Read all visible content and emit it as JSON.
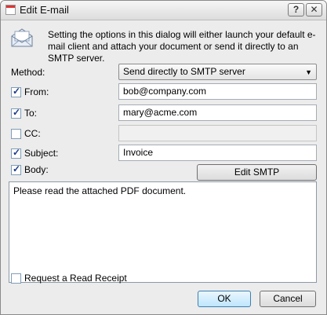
{
  "window": {
    "title": "Edit E-mail",
    "help_label": "?",
    "close_label": "✕"
  },
  "intro": "Setting the options in this dialog will either launch your default e-mail client and attach your document or send it directly to an SMTP server.",
  "method": {
    "label": "Method:",
    "value": "Send directly to SMTP server"
  },
  "from": {
    "label": "From:",
    "checked": true,
    "value": "bob@company.com"
  },
  "to": {
    "label": "To:",
    "checked": true,
    "value": "mary@acme.com"
  },
  "cc": {
    "label": "CC:",
    "checked": false,
    "value": ""
  },
  "subject": {
    "label": "Subject:",
    "checked": true,
    "value": "Invoice"
  },
  "body": {
    "label": "Body:",
    "checked": true,
    "value": "Please read the attached PDF document."
  },
  "edit_smtp_label": "Edit SMTP",
  "read_receipt": {
    "label": "Request a Read Receipt",
    "checked": false
  },
  "ok_label": "OK",
  "cancel_label": "Cancel"
}
